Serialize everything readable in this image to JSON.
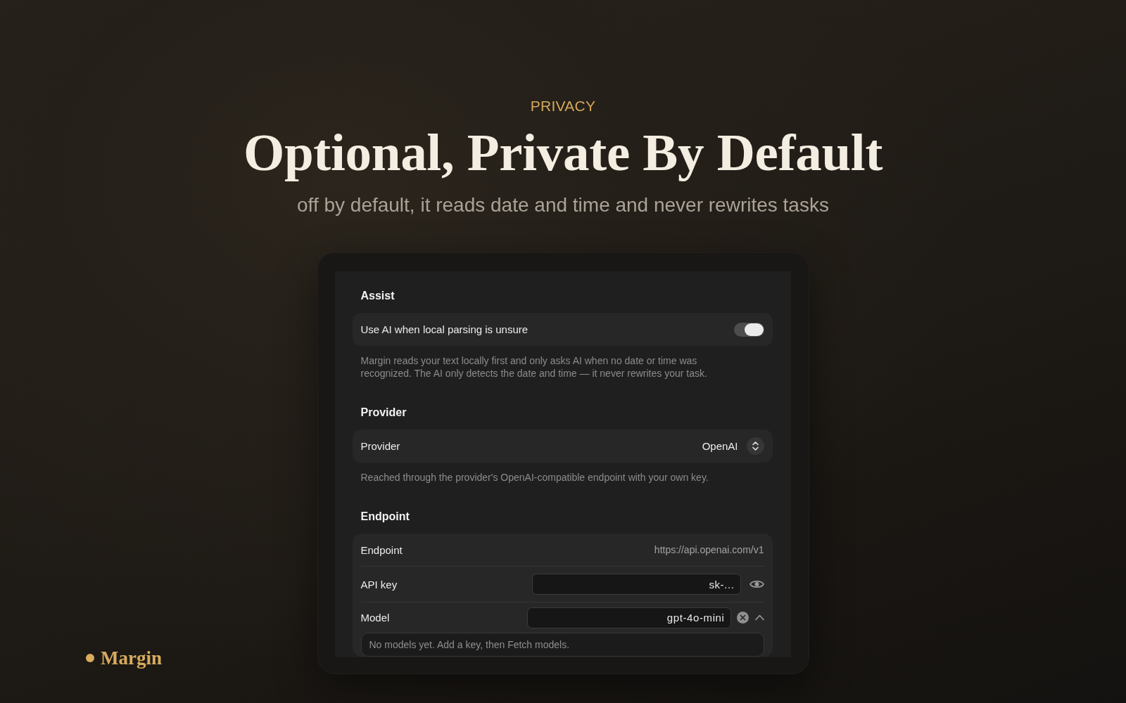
{
  "header": {
    "eyebrow": "PRIVACY",
    "title": "Optional, Private By Default",
    "subtitle": "off by default, it reads date and time and never rewrites tasks"
  },
  "settings": {
    "sections": [
      {
        "heading": "Assist",
        "rows": [
          {
            "kind": "toggle",
            "label": "Use AI when local parsing is unsure",
            "on": true
          }
        ],
        "note": "Margin reads your text locally first and only asks AI when no date or time was recognized. The AI only detects the date and time — it never rewrites your task."
      },
      {
        "heading": "Provider",
        "rows": [
          {
            "kind": "select",
            "label": "Provider",
            "value": "OpenAI"
          }
        ],
        "note": "Reached through the provider's OpenAI-compatible endpoint with your own key."
      },
      {
        "heading": "Endpoint",
        "rows": [
          {
            "kind": "text",
            "label": "Endpoint",
            "value": "https://api.openai.com/v1"
          },
          {
            "kind": "secret",
            "label": "API key",
            "value": "sk-..."
          },
          {
            "kind": "combo",
            "label": "Model",
            "value": "gpt-4o-mini",
            "expanded": true,
            "dropdown_message": "No models yet. Add a key, then Fetch models."
          }
        ]
      }
    ]
  },
  "brand": {
    "name": "Margin"
  }
}
